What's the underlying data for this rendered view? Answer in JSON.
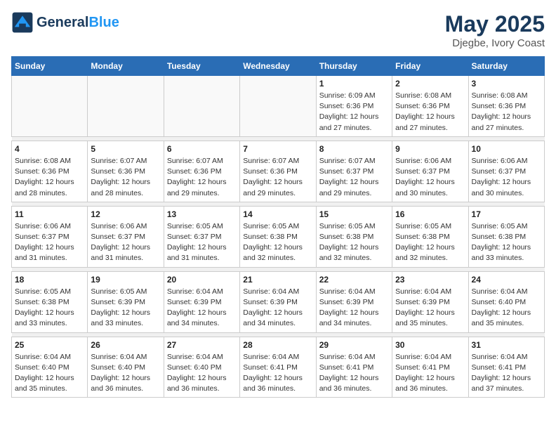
{
  "header": {
    "logo_line1": "General",
    "logo_line2": "Blue",
    "month": "May 2025",
    "location": "Djegbe, Ivory Coast"
  },
  "days_of_week": [
    "Sunday",
    "Monday",
    "Tuesday",
    "Wednesday",
    "Thursday",
    "Friday",
    "Saturday"
  ],
  "weeks": [
    [
      {
        "day": "",
        "info": ""
      },
      {
        "day": "",
        "info": ""
      },
      {
        "day": "",
        "info": ""
      },
      {
        "day": "",
        "info": ""
      },
      {
        "day": "1",
        "info": "Sunrise: 6:09 AM\nSunset: 6:36 PM\nDaylight: 12 hours and 27 minutes."
      },
      {
        "day": "2",
        "info": "Sunrise: 6:08 AM\nSunset: 6:36 PM\nDaylight: 12 hours and 27 minutes."
      },
      {
        "day": "3",
        "info": "Sunrise: 6:08 AM\nSunset: 6:36 PM\nDaylight: 12 hours and 27 minutes."
      }
    ],
    [
      {
        "day": "4",
        "info": "Sunrise: 6:08 AM\nSunset: 6:36 PM\nDaylight: 12 hours and 28 minutes."
      },
      {
        "day": "5",
        "info": "Sunrise: 6:07 AM\nSunset: 6:36 PM\nDaylight: 12 hours and 28 minutes."
      },
      {
        "day": "6",
        "info": "Sunrise: 6:07 AM\nSunset: 6:36 PM\nDaylight: 12 hours and 29 minutes."
      },
      {
        "day": "7",
        "info": "Sunrise: 6:07 AM\nSunset: 6:36 PM\nDaylight: 12 hours and 29 minutes."
      },
      {
        "day": "8",
        "info": "Sunrise: 6:07 AM\nSunset: 6:37 PM\nDaylight: 12 hours and 29 minutes."
      },
      {
        "day": "9",
        "info": "Sunrise: 6:06 AM\nSunset: 6:37 PM\nDaylight: 12 hours and 30 minutes."
      },
      {
        "day": "10",
        "info": "Sunrise: 6:06 AM\nSunset: 6:37 PM\nDaylight: 12 hours and 30 minutes."
      }
    ],
    [
      {
        "day": "11",
        "info": "Sunrise: 6:06 AM\nSunset: 6:37 PM\nDaylight: 12 hours and 31 minutes."
      },
      {
        "day": "12",
        "info": "Sunrise: 6:06 AM\nSunset: 6:37 PM\nDaylight: 12 hours and 31 minutes."
      },
      {
        "day": "13",
        "info": "Sunrise: 6:05 AM\nSunset: 6:37 PM\nDaylight: 12 hours and 31 minutes."
      },
      {
        "day": "14",
        "info": "Sunrise: 6:05 AM\nSunset: 6:38 PM\nDaylight: 12 hours and 32 minutes."
      },
      {
        "day": "15",
        "info": "Sunrise: 6:05 AM\nSunset: 6:38 PM\nDaylight: 12 hours and 32 minutes."
      },
      {
        "day": "16",
        "info": "Sunrise: 6:05 AM\nSunset: 6:38 PM\nDaylight: 12 hours and 32 minutes."
      },
      {
        "day": "17",
        "info": "Sunrise: 6:05 AM\nSunset: 6:38 PM\nDaylight: 12 hours and 33 minutes."
      }
    ],
    [
      {
        "day": "18",
        "info": "Sunrise: 6:05 AM\nSunset: 6:38 PM\nDaylight: 12 hours and 33 minutes."
      },
      {
        "day": "19",
        "info": "Sunrise: 6:05 AM\nSunset: 6:39 PM\nDaylight: 12 hours and 33 minutes."
      },
      {
        "day": "20",
        "info": "Sunrise: 6:04 AM\nSunset: 6:39 PM\nDaylight: 12 hours and 34 minutes."
      },
      {
        "day": "21",
        "info": "Sunrise: 6:04 AM\nSunset: 6:39 PM\nDaylight: 12 hours and 34 minutes."
      },
      {
        "day": "22",
        "info": "Sunrise: 6:04 AM\nSunset: 6:39 PM\nDaylight: 12 hours and 34 minutes."
      },
      {
        "day": "23",
        "info": "Sunrise: 6:04 AM\nSunset: 6:39 PM\nDaylight: 12 hours and 35 minutes."
      },
      {
        "day": "24",
        "info": "Sunrise: 6:04 AM\nSunset: 6:40 PM\nDaylight: 12 hours and 35 minutes."
      }
    ],
    [
      {
        "day": "25",
        "info": "Sunrise: 6:04 AM\nSunset: 6:40 PM\nDaylight: 12 hours and 35 minutes."
      },
      {
        "day": "26",
        "info": "Sunrise: 6:04 AM\nSunset: 6:40 PM\nDaylight: 12 hours and 36 minutes."
      },
      {
        "day": "27",
        "info": "Sunrise: 6:04 AM\nSunset: 6:40 PM\nDaylight: 12 hours and 36 minutes."
      },
      {
        "day": "28",
        "info": "Sunrise: 6:04 AM\nSunset: 6:41 PM\nDaylight: 12 hours and 36 minutes."
      },
      {
        "day": "29",
        "info": "Sunrise: 6:04 AM\nSunset: 6:41 PM\nDaylight: 12 hours and 36 minutes."
      },
      {
        "day": "30",
        "info": "Sunrise: 6:04 AM\nSunset: 6:41 PM\nDaylight: 12 hours and 36 minutes."
      },
      {
        "day": "31",
        "info": "Sunrise: 6:04 AM\nSunset: 6:41 PM\nDaylight: 12 hours and 37 minutes."
      }
    ]
  ]
}
